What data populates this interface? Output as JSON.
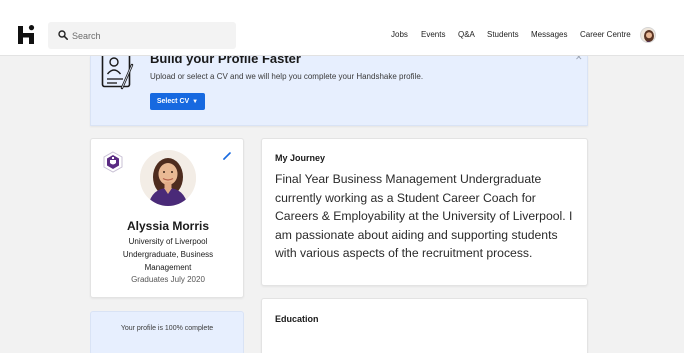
{
  "header": {
    "logo": "handshake-logo-icon",
    "search": {
      "placeholder": "Search",
      "value": ""
    },
    "nav": [
      {
        "label": "Jobs"
      },
      {
        "label": "Events"
      },
      {
        "label": "Q&A"
      },
      {
        "label": "Students"
      },
      {
        "label": "Messages"
      },
      {
        "label": "Career Centre"
      }
    ]
  },
  "cv_banner": {
    "title": "Build your Profile Faster",
    "subtitle": "Upload or select a CV and we will help you complete your Handshake profile.",
    "button_label": "Select CV",
    "icon": "cv-document-icon"
  },
  "profile": {
    "name": "Alyssia Morris",
    "lines": [
      "University of Liverpool",
      "Undergraduate, Business",
      "Management"
    ],
    "graduation": "Graduates July 2020",
    "completion": "Your profile is 100% complete"
  },
  "journey": {
    "heading": "My Journey",
    "text": "Final Year Business Management Undergraduate currently working as a Student Career Coach for Careers & Employability at the University of Liverpool. I am passionate about aiding and supporting students with various aspects of the recruitment process."
  },
  "education": {
    "heading": "Education"
  },
  "colors": {
    "accent": "#1769e0",
    "banner_bg": "#e7effe",
    "page_bg": "#f2f2f2"
  }
}
